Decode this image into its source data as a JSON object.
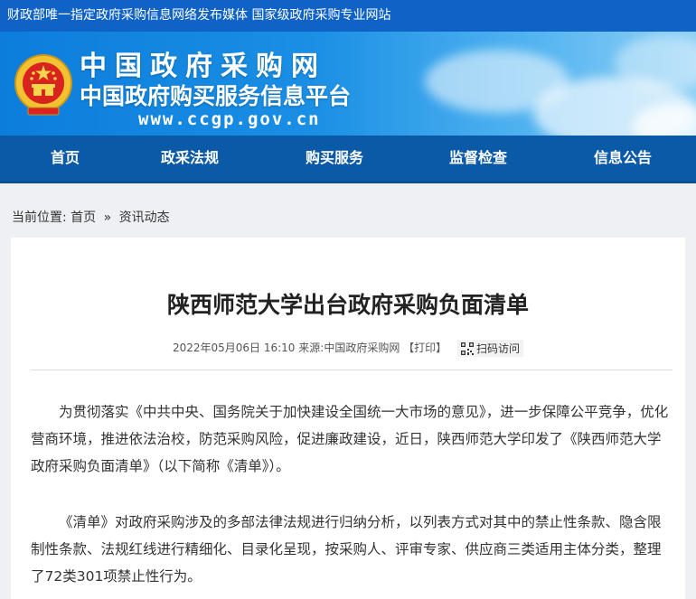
{
  "topbar": {
    "text": "财政部唯一指定政府采购信息网络发布媒体 国家级政府采购专业网站"
  },
  "header": {
    "title": "中国政府采购网",
    "subtitle": "中国政府购买服务信息平台",
    "url": "www.ccgp.gov.cn",
    "emblem_icon": "national-emblem-icon"
  },
  "nav": {
    "items": [
      {
        "label": "首页"
      },
      {
        "label": "政采法规"
      },
      {
        "label": "购买服务"
      },
      {
        "label": "监督检查"
      },
      {
        "label": "信息公告"
      }
    ]
  },
  "breadcrumb": {
    "prefix": "当前位置:",
    "home": "首页",
    "separator": "»",
    "current": "资讯动态"
  },
  "article": {
    "title": "陕西师范大学出台政府采购负面清单",
    "meta": {
      "datetime": "2022年05月06日 16:10",
      "source": "来源:中国政府采购网",
      "print": "【打印】",
      "scan": "扫码访问",
      "scan_icon": "qr-code-icon"
    },
    "paragraphs": [
      "为贯彻落实《中共中央、国务院关于加快建设全国统一大市场的意见》，进一步保障公平竞争，优化营商环境，推进依法治校，防范采购风险，促进廉政建设，近日，陕西师范大学印发了《陕西师范大学政府采购负面清单》（以下简称《清单》）。",
      "《清单》对政府采购涉及的多部法律法规进行归纳分析，以列表方式对其中的禁止性条款、隐含限制性条款、法规红线进行精细化、目录化呈现，按采购人、评审专家、供应商三类适用主体分类，整理了72类301项禁止性行为。"
    ]
  },
  "colors": {
    "topbar": "#0f63c6",
    "nav": "#0b5aa8",
    "page_bg": "#eef0f3"
  }
}
